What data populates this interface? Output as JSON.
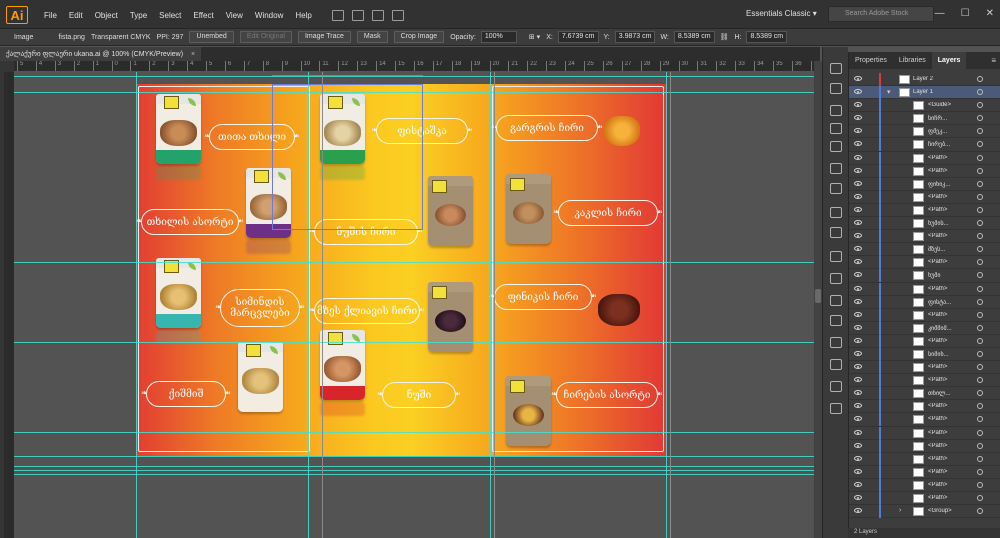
{
  "app": {
    "logo_text": "Ai"
  },
  "menu": [
    "File",
    "Edit",
    "Object",
    "Type",
    "Select",
    "Effect",
    "View",
    "Window",
    "Help"
  ],
  "workspace": "Essentials Classic",
  "stock_search_placeholder": "Search Adobe Stock",
  "control_bar": {
    "mode": "Image",
    "file_name": "fista.png",
    "color_mode": "Transparent CMYK",
    "ppi": "PPI: 297",
    "unembed": "Unembed",
    "edit_original": "Edit Original",
    "image_trace": "Image Trace",
    "mask": "Mask",
    "crop_image": "Crop Image",
    "opacity_label": "Opacity:",
    "opacity_value": "100%",
    "x_label": "X:",
    "x_value": "7.6739 cm",
    "y_label": "Y:",
    "y_value": "3.9873 cm",
    "w_label": "W:",
    "w_value": "8.5389 cm",
    "h_label": "H:",
    "h_value": "8.5389 cm"
  },
  "document_tab": {
    "title": "ქალაქური ფლაერი ukana.ai @ 100% (CMYK/Preview)",
    "close": "×"
  },
  "ruler_ticks": [
    "5",
    "4",
    "3",
    "2",
    "1",
    "0",
    "1",
    "2",
    "3",
    "4",
    "5",
    "6",
    "7",
    "8",
    "9",
    "10",
    "11",
    "12",
    "13",
    "14",
    "15",
    "16",
    "17",
    "18",
    "19",
    "20",
    "21",
    "22",
    "23",
    "24",
    "25",
    "26",
    "27",
    "28",
    "29",
    "30",
    "31",
    "32",
    "33",
    "34",
    "35",
    "36",
    "37"
  ],
  "products": {
    "tita_tkhili": "თითა თხილი",
    "tkhilis_asorti": "თხილის ასორტი",
    "semechkis_marcvlebi": "სიმინდის მარცვლები",
    "kishmishi": "ქიშმიშ",
    "fistashka": "ფისტაშკა",
    "nushis_chiri": "ნუშის ჩირი",
    "mzesumziris_chiri": "მზეს ქლიავის ჩირი",
    "nushi": "ნუში",
    "gargris_chiri": "გარგრის ჩირი",
    "kakalis_chiri": "კაკლის ჩირი",
    "finikis_chiri": "ფინიკის ჩირი",
    "chirebis_asorti": "ჩირების ასორტი"
  },
  "panel_tabs": [
    "Properties",
    "Libraries",
    "Layers"
  ],
  "panel_menu_icon": "≡",
  "layers": [
    {
      "name": "Layer 2",
      "kind": "layer",
      "color": "#e0393e"
    },
    {
      "name": "Layer 1",
      "kind": "layer",
      "color": "#4f7bdc",
      "active": true,
      "expander": "▾"
    },
    {
      "name": "<Guide>",
      "kind": "item"
    },
    {
      "name": "სიჩრ...",
      "kind": "item"
    },
    {
      "name": "ფშეკ...",
      "kind": "item"
    },
    {
      "name": "ჩირებ...",
      "kind": "item"
    },
    {
      "name": "<Path>",
      "kind": "item"
    },
    {
      "name": "<Path>",
      "kind": "item"
    },
    {
      "name": "ფინიკ...",
      "kind": "item"
    },
    {
      "name": "<Path>",
      "kind": "item"
    },
    {
      "name": "<Path>",
      "kind": "item"
    },
    {
      "name": "ნუშის...",
      "kind": "item"
    },
    {
      "name": "<Path>",
      "kind": "item"
    },
    {
      "name": "მზეს...",
      "kind": "item"
    },
    {
      "name": "<Path>",
      "kind": "item"
    },
    {
      "name": "ნუში",
      "kind": "item"
    },
    {
      "name": "<Path>",
      "kind": "item"
    },
    {
      "name": "ფისტა...",
      "kind": "item"
    },
    {
      "name": "<Path>",
      "kind": "item"
    },
    {
      "name": "კიშმიშ...",
      "kind": "item"
    },
    {
      "name": "<Path>",
      "kind": "item"
    },
    {
      "name": "სიმინ...",
      "kind": "item"
    },
    {
      "name": "<Path>",
      "kind": "item"
    },
    {
      "name": "<Path>",
      "kind": "item"
    },
    {
      "name": "თხილ...",
      "kind": "item"
    },
    {
      "name": "<Path>",
      "kind": "item"
    },
    {
      "name": "<Path>",
      "kind": "item"
    },
    {
      "name": "<Path>",
      "kind": "item"
    },
    {
      "name": "<Path>",
      "kind": "item"
    },
    {
      "name": "<Path>",
      "kind": "item"
    },
    {
      "name": "<Path>",
      "kind": "item"
    },
    {
      "name": "<Path>",
      "kind": "item"
    },
    {
      "name": "<Path>",
      "kind": "item"
    },
    {
      "name": "<Group>",
      "kind": "item",
      "expander": "›"
    }
  ],
  "layers_footer": "2 Layers",
  "window_controls": [
    "—",
    "☐",
    "✕"
  ]
}
